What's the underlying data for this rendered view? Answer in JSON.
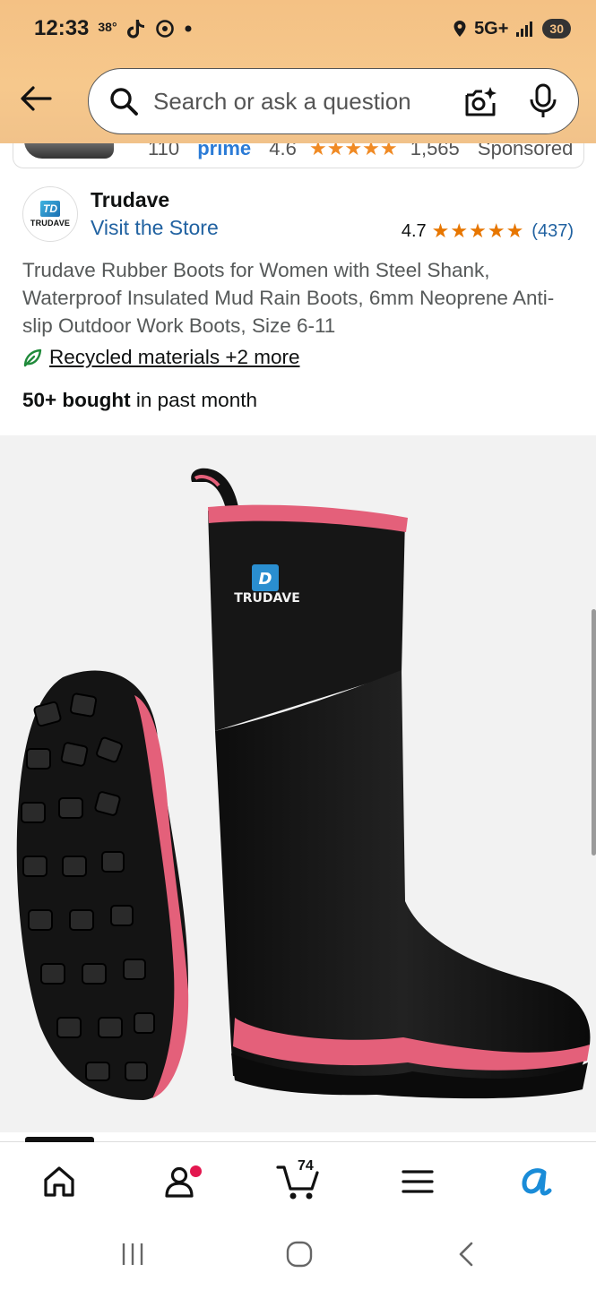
{
  "status_bar": {
    "time": "12:33",
    "temperature": "38°",
    "network": "5G+",
    "battery": "30"
  },
  "search": {
    "placeholder": "Search or ask a question"
  },
  "sponsored_strip": {
    "price": "110",
    "prime": "prime",
    "rating": "4.6",
    "stars": "★★★★★",
    "reviews": "1,565",
    "label": "Sponsored"
  },
  "brand": {
    "logo_mark": "TD",
    "logo_word": "TRUDAVE",
    "name": "Trudave",
    "visit_store": "Visit the Store",
    "rating": "4.7",
    "stars": "★★★★★",
    "review_count": "(437)"
  },
  "product": {
    "title": "Trudave Rubber Boots for Women with Steel Shank, Waterproof Insulated Mud Rain Boots, 6mm Neoprene Anti-slip Outdoor Work Boots, Size 6-11",
    "recycled": "Recycled materials +2 more",
    "bought_bold": "50+ bought",
    "bought_rest": " in past month",
    "image_logo_word": "TRUDAVE"
  },
  "bottom_nav": {
    "cart_count": "74"
  },
  "colors": {
    "header": "#f4c184",
    "link": "#2162a1",
    "star": "#e77600",
    "boot_pink": "#e4607a",
    "accent_blue": "#1a8cd8"
  }
}
